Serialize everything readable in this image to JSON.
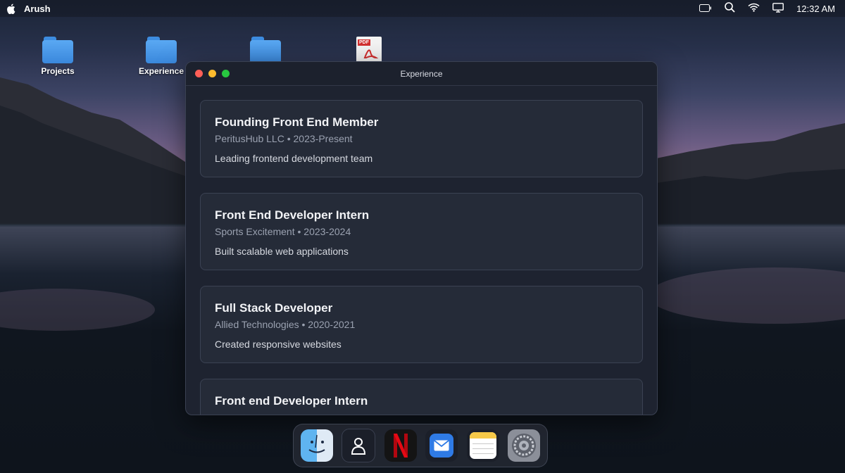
{
  "menubar": {
    "app_name": "Arush",
    "clock": "12:32 AM",
    "icons": [
      "apple-icon",
      "battery-icon",
      "search-icon",
      "wifi-icon",
      "display-icon"
    ]
  },
  "desktop": {
    "items": [
      {
        "label": "Projects",
        "icon": "folder-icon"
      },
      {
        "label": "Experience",
        "icon": "folder-icon"
      },
      {
        "label": "",
        "icon": "folder-icon"
      },
      {
        "label": "",
        "icon": "pdf-icon",
        "badge": "PDF"
      }
    ]
  },
  "window": {
    "title": "Experience",
    "experiences": [
      {
        "role": "Founding Front End Member",
        "meta": "PeritusHub LLC • 2023-Present",
        "desc": "Leading frontend development team"
      },
      {
        "role": "Front End Developer Intern",
        "meta": "Sports Excitement • 2023-2024",
        "desc": "Built scalable web applications"
      },
      {
        "role": "Full Stack Developer",
        "meta": "Allied Technologies • 2020-2021",
        "desc": "Created responsive websites"
      },
      {
        "role": "Front end Developer Intern",
        "meta": "",
        "desc": ""
      }
    ]
  },
  "dock": {
    "apps": [
      "finder-icon",
      "contacts-icon",
      "netflix-icon",
      "mail-icon",
      "notes-icon",
      "settings-icon"
    ]
  },
  "colors": {
    "card_bg": "#252b38",
    "window_bg": "#1e2330",
    "accent_mail": "#2f7be6",
    "netflix_red": "#e50914"
  }
}
